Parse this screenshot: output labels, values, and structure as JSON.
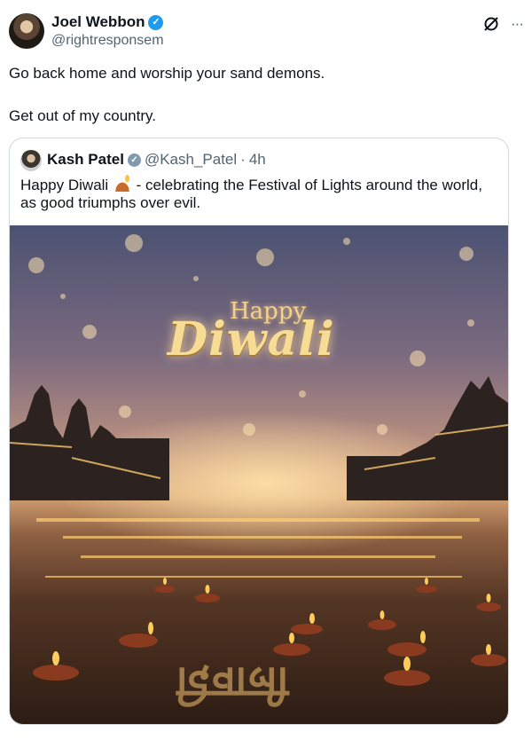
{
  "tweet": {
    "author_name": "Joel Webbon",
    "author_handle": "@rightresponsem",
    "verified_mark": "✓",
    "more_icon": "···",
    "lines": [
      "Go back home and worship your sand demons.",
      "Get out of my country."
    ]
  },
  "quoted": {
    "author_name": "Kash Patel",
    "author_handle": "@Kash_Patel",
    "separator": "·",
    "time": "4h",
    "badge_mark": "✓",
    "text_before_emoji": "Happy Diwali",
    "text_after_emoji": " - celebrating the Festival of Lights around the world, as good triumphs over evil.",
    "image": {
      "greeting_small": "Happy",
      "greeting_large": "Diwali",
      "reflection": "दिवाली",
      "colors": {
        "sky_top": "#4b5272",
        "glow": "#d4a173",
        "water_dark": "#2c1c14",
        "flame": "#ffc542"
      }
    }
  }
}
